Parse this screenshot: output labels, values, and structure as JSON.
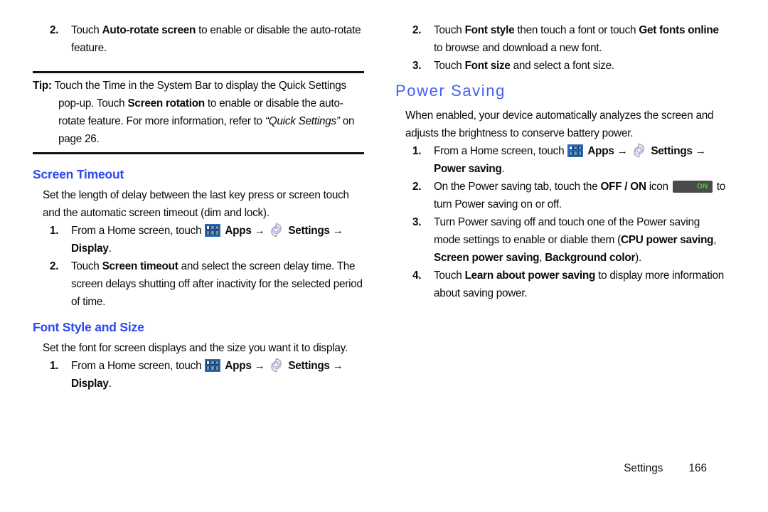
{
  "document": {
    "type": "user-manual-page",
    "footer": {
      "section": "Settings",
      "page_number": "166"
    },
    "colors": {
      "subheading_blue": "#2c49ee",
      "heading_blue": "#4161ef",
      "toggle_background": "#4a4a4a",
      "toggle_on_text": "#4fd02a",
      "apps_icon_frame": "#2f6bbf",
      "rule_black": "#121212"
    },
    "icons": {
      "apps": "apps-grid-icon",
      "settings": "gear-icon",
      "toggle_on": "toggle-on-icon",
      "arrow": "→"
    }
  },
  "left_column": {
    "step_auto_rotate": {
      "number": "2.",
      "t1": "Touch ",
      "b1": "Auto-rotate screen",
      "t2": " to enable or disable the auto-rotate feature."
    },
    "tip": {
      "label": "Tip:",
      "t1": " Touch the Time in the System Bar to display the Quick Settings pop-up. Touch ",
      "b1": "Screen rotation",
      "t2": " to enable or disable the auto-rotate feature. For more information, refer to ",
      "i1": "“Quick Settings”",
      "t3": " on page 26."
    },
    "screen_timeout": {
      "heading": "Screen Timeout",
      "intro": "Set the length of delay between the last key press or screen touch and the automatic screen timeout (dim and lock).",
      "step1": {
        "number": "1.",
        "t1": "From a Home screen, touch ",
        "apps_label": "Apps",
        "settings_label": "Settings",
        "dest_label": "Display",
        "period": "."
      },
      "step2": {
        "number": "2.",
        "t1": "Touch ",
        "b1": "Screen timeout",
        "t2": " and select the screen delay time. The screen delays shutting off after inactivity for the selected period of time."
      }
    },
    "font_style_and_size": {
      "heading": "Font Style and Size",
      "intro": "Set the font for screen displays and the size you want it to display.",
      "step1": {
        "number": "1.",
        "t1": "From a Home screen, touch ",
        "apps_label": "Apps",
        "settings_label": "Settings",
        "dest_label": "Display",
        "period": "."
      }
    }
  },
  "right_column": {
    "font_steps": {
      "step2": {
        "number": "2.",
        "t1": "Touch ",
        "b1": "Font style",
        "t2": " then touch a font or touch ",
        "b2": "Get fonts online",
        "t3": " to browse and download a new font."
      },
      "step3": {
        "number": "3.",
        "t1": "Touch ",
        "b1": "Font size",
        "t2": " and select a font size."
      }
    },
    "power_saving": {
      "heading": "Power Saving",
      "intro": "When enabled, your device automatically analyzes the screen and adjusts the brightness to conserve battery power.",
      "step1": {
        "number": "1.",
        "t1": "From a Home screen, touch ",
        "apps_label": "Apps",
        "settings_label": "Settings",
        "dest_label": "Power saving",
        "period": "."
      },
      "step2": {
        "number": "2.",
        "t1": "On the Power saving tab, touch the ",
        "b1": "OFF / ON",
        "t2": " icon ",
        "toggle_label": "ON",
        "t3": " to turn Power saving on or off."
      },
      "step3": {
        "number": "3.",
        "t1": "Turn Power saving off and touch one of the Power saving mode settings to enable or diable them (",
        "b1": "CPU power saving",
        "t2": ", ",
        "b2": "Screen power saving",
        "t3": ", ",
        "b3": "Background color",
        "t4": ")."
      },
      "step4": {
        "number": "4.",
        "t1": "Touch ",
        "b1": "Learn about power saving",
        "t2": " to display more information about saving power."
      }
    }
  }
}
